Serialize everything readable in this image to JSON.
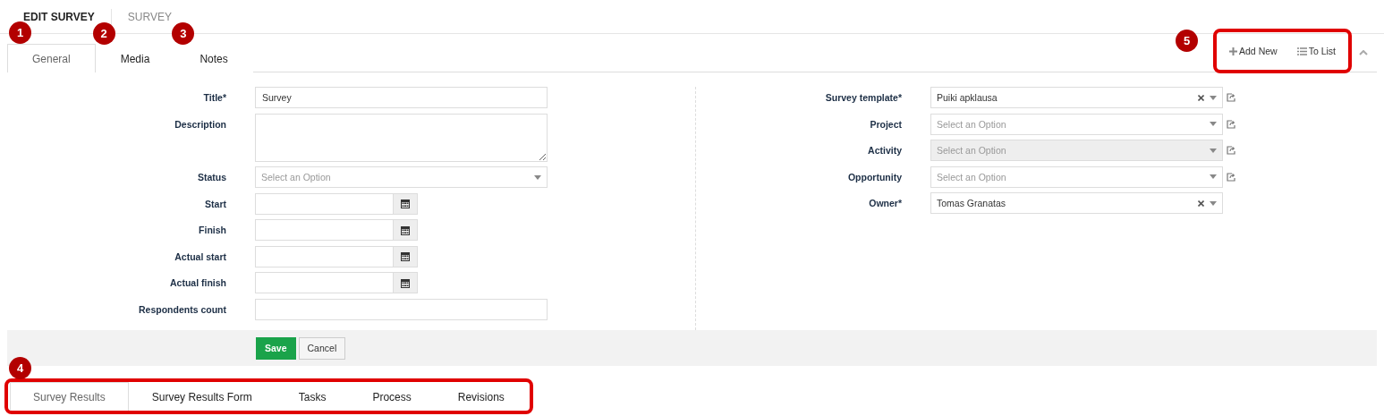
{
  "page_tabs": [
    {
      "label": "EDIT SURVEY",
      "selected": true
    },
    {
      "label": "SURVEY",
      "selected": false
    }
  ],
  "section_tabs": [
    {
      "label": "General",
      "selected": true,
      "badge": "1"
    },
    {
      "label": "Media",
      "selected": false,
      "badge": "2"
    },
    {
      "label": "Notes",
      "selected": false,
      "badge": "3"
    }
  ],
  "actions": {
    "badge": "5",
    "highlighted": true,
    "items": [
      {
        "kind": "add",
        "label": "Add New"
      },
      {
        "kind": "list",
        "label": "To List"
      }
    ]
  },
  "left_fields": [
    {
      "kind": "text",
      "label": "Title*",
      "value": "Survey"
    },
    {
      "kind": "textarea",
      "label": "Description"
    },
    {
      "kind": "select",
      "label": "Status",
      "placeholder": "Select an Option"
    },
    {
      "kind": "date",
      "label": "Start"
    },
    {
      "kind": "date",
      "label": "Finish"
    },
    {
      "kind": "date",
      "label": "Actual start"
    },
    {
      "kind": "date",
      "label": "Actual finish"
    },
    {
      "kind": "text",
      "label": "Respondents count"
    }
  ],
  "right_fields": [
    {
      "label": "Survey template*",
      "value": "Puiki apklausa",
      "clearable": true,
      "disabled": false,
      "link": true
    },
    {
      "label": "Project",
      "placeholder": "Select an Option",
      "clearable": false,
      "disabled": false,
      "link": true
    },
    {
      "label": "Activity",
      "placeholder": "Select an Option",
      "clearable": false,
      "disabled": true,
      "link": true
    },
    {
      "label": "Opportunity",
      "placeholder": "Select an Option",
      "clearable": false,
      "disabled": false,
      "link": true
    },
    {
      "label": "Owner*",
      "value": "Tomas Granatas",
      "clearable": true,
      "disabled": false,
      "link": false
    }
  ],
  "buttons": [
    {
      "kind": "primary",
      "label": "Save"
    },
    {
      "kind": "default",
      "label": "Cancel"
    }
  ],
  "bottom_tabs": {
    "badge": "4",
    "highlighted": true,
    "items": [
      {
        "label": "Survey Results",
        "selected": true
      },
      {
        "label": "Survey Results Form",
        "selected": false
      },
      {
        "label": "Tasks",
        "selected": false
      },
      {
        "label": "Process",
        "selected": false
      },
      {
        "label": "Revisions",
        "selected": false
      }
    ]
  }
}
